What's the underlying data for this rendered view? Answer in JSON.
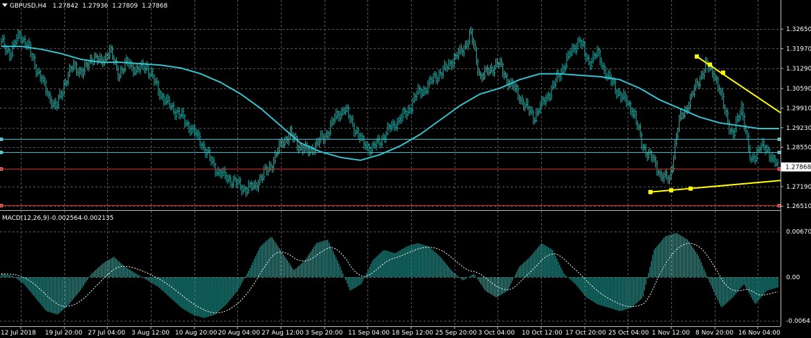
{
  "header": {
    "symbol": "GBPUSD,H4",
    "open": "1.27842",
    "high": "1.27936",
    "low": "1.27809",
    "close": "1.27868"
  },
  "macd_header": {
    "name": "MACD(12,26,9)",
    "main": "-0.002564",
    "signal": "-0.002135"
  },
  "price_axis": {
    "labels": [
      "1.32650",
      "1.31970",
      "1.31290",
      "1.30590",
      "1.29910",
      "1.29230",
      "1.28550",
      "1.27190",
      "1.26510"
    ],
    "current_price": "1.27868",
    "range": [
      1.2642,
      1.333
    ]
  },
  "macd_axis": {
    "labels": [
      "0.006705",
      "0.00",
      "-0.006411"
    ],
    "range": [
      -0.007,
      0.0072
    ]
  },
  "time_axis": {
    "labels": [
      "12 Jul 2018",
      "19 Jul 20:00",
      "27 Jul 04:00",
      "3 Aug 12:00",
      "10 Aug 20:00",
      "20 Aug 04:00",
      "27 Aug 12:00",
      "3 Sep 20:00",
      "11 Sep 04:00",
      "18 Sep 12:00",
      "25 Sep 20:00",
      "3 Oct 04:00",
      "10 Oct 12:00",
      "17 Oct 20:00",
      "25 Oct 04:00",
      "1 Nov 12:00",
      "8 Nov 20:00",
      "16 Nov 04:00"
    ]
  },
  "colors": {
    "background": "#000000",
    "grid": "#5a5a5a",
    "candles": "#20b2aa",
    "moving_average": "#33c4d0",
    "hlines_cyan": "#33c4d0",
    "hlines_red": "#e02020",
    "trendline": "#ffff00",
    "macd_hist": "#20b2aa",
    "macd_signal": "#ffffff"
  },
  "chart_data": {
    "type": "line",
    "symbol": "GBPUSD",
    "timeframe": "H4",
    "close_series": [
      {
        "t": "12 Jul",
        "v": 1.322
      },
      {
        "t": "",
        "v": 1.318
      },
      {
        "t": "",
        "v": 1.325
      },
      {
        "t": "",
        "v": 1.32
      },
      {
        "t": "",
        "v": 1.312
      },
      {
        "t": "",
        "v": 1.305
      },
      {
        "t": "",
        "v": 1.299
      },
      {
        "t": "",
        "v": 1.308
      },
      {
        "t": "19 Jul",
        "v": 1.314
      },
      {
        "t": "",
        "v": 1.311
      },
      {
        "t": "",
        "v": 1.317
      },
      {
        "t": "",
        "v": 1.315
      },
      {
        "t": "",
        "v": 1.319
      },
      {
        "t": "",
        "v": 1.311
      },
      {
        "t": "",
        "v": 1.315
      },
      {
        "t": "27 Jul",
        "v": 1.312
      },
      {
        "t": "",
        "v": 1.314
      },
      {
        "t": "",
        "v": 1.308
      },
      {
        "t": "",
        "v": 1.302
      },
      {
        "t": "",
        "v": 1.299
      },
      {
        "t": "3 Aug",
        "v": 1.296
      },
      {
        "t": "",
        "v": 1.292
      },
      {
        "t": "",
        "v": 1.288
      },
      {
        "t": "",
        "v": 1.282
      },
      {
        "t": "",
        "v": 1.277
      },
      {
        "t": "10 Aug",
        "v": 1.275
      },
      {
        "t": "",
        "v": 1.273
      },
      {
        "t": "",
        "v": 1.271
      },
      {
        "t": "",
        "v": 1.272
      },
      {
        "t": "",
        "v": 1.276
      },
      {
        "t": "",
        "v": 1.28
      },
      {
        "t": "20 Aug",
        "v": 1.287
      },
      {
        "t": "",
        "v": 1.29
      },
      {
        "t": "",
        "v": 1.286
      },
      {
        "t": "",
        "v": 1.284
      },
      {
        "t": "",
        "v": 1.287
      },
      {
        "t": "27 Aug",
        "v": 1.29
      },
      {
        "t": "",
        "v": 1.296
      },
      {
        "t": "",
        "v": 1.299
      },
      {
        "t": "",
        "v": 1.293
      },
      {
        "t": "",
        "v": 1.287
      },
      {
        "t": "3 Sep",
        "v": 1.285
      },
      {
        "t": "",
        "v": 1.288
      },
      {
        "t": "",
        "v": 1.292
      },
      {
        "t": "",
        "v": 1.295
      },
      {
        "t": "",
        "v": 1.298
      },
      {
        "t": "11 Sep",
        "v": 1.304
      },
      {
        "t": "",
        "v": 1.306
      },
      {
        "t": "",
        "v": 1.31
      },
      {
        "t": "",
        "v": 1.312
      },
      {
        "t": "",
        "v": 1.316
      },
      {
        "t": "18 Sep",
        "v": 1.319
      },
      {
        "t": "",
        "v": 1.325
      },
      {
        "t": "",
        "v": 1.31
      },
      {
        "t": "",
        "v": 1.312
      },
      {
        "t": "25 Sep",
        "v": 1.315
      },
      {
        "t": "",
        "v": 1.309
      },
      {
        "t": "",
        "v": 1.305
      },
      {
        "t": "",
        "v": 1.3
      },
      {
        "t": "3 Oct",
        "v": 1.296
      },
      {
        "t": "",
        "v": 1.301
      },
      {
        "t": "",
        "v": 1.306
      },
      {
        "t": "",
        "v": 1.312
      },
      {
        "t": "10 Oct",
        "v": 1.318
      },
      {
        "t": "",
        "v": 1.323
      },
      {
        "t": "",
        "v": 1.315
      },
      {
        "t": "",
        "v": 1.318
      },
      {
        "t": "17 Oct",
        "v": 1.311
      },
      {
        "t": "",
        "v": 1.306
      },
      {
        "t": "",
        "v": 1.302
      },
      {
        "t": "",
        "v": 1.298
      },
      {
        "t": "25 Oct",
        "v": 1.286
      },
      {
        "t": "",
        "v": 1.282
      },
      {
        "t": "",
        "v": 1.276
      },
      {
        "t": "",
        "v": 1.274
      },
      {
        "t": "1 Nov",
        "v": 1.294
      },
      {
        "t": "",
        "v": 1.3
      },
      {
        "t": "",
        "v": 1.307
      },
      {
        "t": "",
        "v": 1.314
      },
      {
        "t": "8 Nov",
        "v": 1.311
      },
      {
        "t": "",
        "v": 1.3
      },
      {
        "t": "",
        "v": 1.289
      },
      {
        "t": "",
        "v": 1.3
      },
      {
        "t": "16 Nov",
        "v": 1.28
      },
      {
        "t": "",
        "v": 1.286
      },
      {
        "t": "",
        "v": 1.284
      },
      {
        "t": "",
        "v": 1.2787
      }
    ],
    "moving_average": [
      1.3205,
      1.3205,
      1.3195,
      1.318,
      1.316,
      1.315,
      1.315,
      1.3145,
      1.314,
      1.313,
      1.311,
      1.308,
      1.304,
      1.299,
      1.293,
      1.287,
      1.284,
      1.282,
      1.281,
      1.283,
      1.286,
      1.29,
      1.295,
      1.3,
      1.304,
      1.306,
      1.309,
      1.311,
      1.311,
      1.3105,
      1.31,
      1.309,
      1.306,
      1.302,
      1.299,
      1.296,
      1.294,
      1.293,
      1.292,
      1.292
    ],
    "horizontal_lines": [
      {
        "price": 1.2885,
        "color": "cyan"
      },
      {
        "price": 1.2838,
        "color": "cyan"
      },
      {
        "price": 1.2781,
        "color": "red"
      },
      {
        "price": 1.2654,
        "color": "red"
      }
    ],
    "trendlines": [
      {
        "from": {
          "t": "5 Nov",
          "v": 1.317
        },
        "to": {
          "t": "21 Nov",
          "v": 1.2975
        }
      },
      {
        "from": {
          "t": "26 Oct",
          "v": 1.27
        },
        "to": {
          "t": "21 Nov",
          "v": 1.274
        }
      }
    ],
    "macd_histogram": [
      0.0005,
      0.0002,
      -0.001,
      -0.003,
      -0.005,
      -0.0055,
      -0.004,
      -0.002,
      0.0005,
      0.002,
      0.003,
      0.0015,
      0.0005,
      -0.0005,
      -0.0015,
      -0.003,
      -0.0045,
      -0.0055,
      -0.006,
      -0.0055,
      -0.004,
      -0.002,
      0.001,
      0.0045,
      0.006,
      0.0035,
      0.001,
      0.0025,
      0.005,
      0.0055,
      0.002,
      -0.002,
      -0.001,
      0.0025,
      0.004,
      0.0035,
      0.0045,
      0.005,
      0.0045,
      0.003,
      0.001,
      -0.0005,
      0.0005,
      -0.002,
      -0.003,
      -0.002,
      0.0015,
      0.003,
      0.005,
      0.004,
      0.0005,
      -0.001,
      -0.003,
      -0.004,
      -0.0045,
      -0.005,
      -0.0045,
      -0.003,
      0.004,
      0.006,
      0.0065,
      0.0055,
      0.003,
      -0.001,
      -0.0045,
      -0.003,
      -0.001,
      -0.004,
      -0.002,
      -0.0015
    ]
  }
}
